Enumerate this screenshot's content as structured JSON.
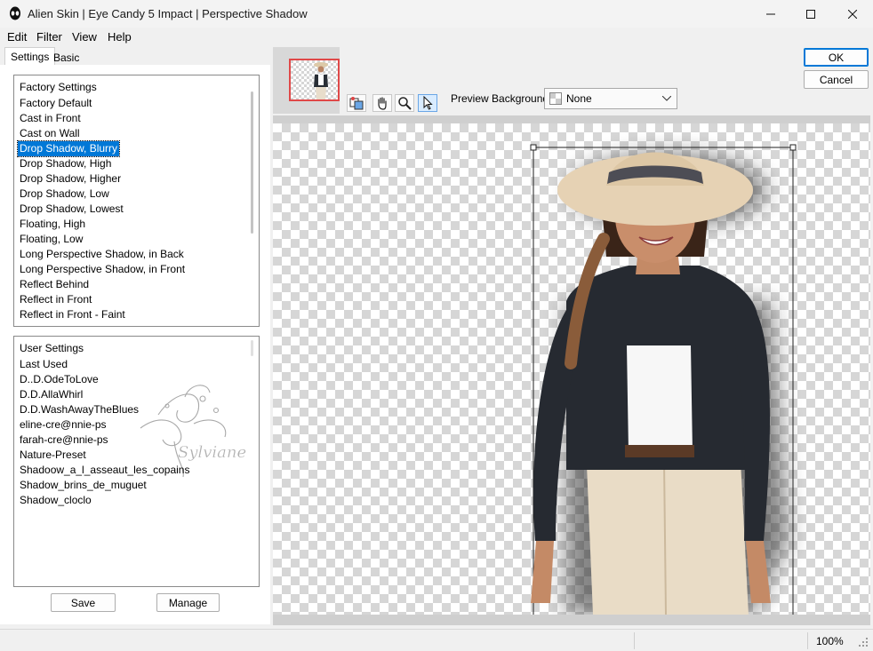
{
  "window": {
    "title": "Alien Skin | Eye Candy 5 Impact | Perspective Shadow",
    "app_icon": "alien-head-icon"
  },
  "menu": [
    "Edit",
    "Filter",
    "View",
    "Help"
  ],
  "tabs": [
    "Settings",
    "Basic"
  ],
  "factory_settings": {
    "heading": "Factory Settings",
    "items": [
      "Factory Default",
      "Cast in Front",
      "Cast on Wall",
      "Drop Shadow, Blurry",
      "Drop Shadow, High",
      "Drop Shadow, Higher",
      "Drop Shadow, Low",
      "Drop Shadow, Lowest",
      "Floating, High",
      "Floating, Low",
      "Long Perspective Shadow, in Back",
      "Long Perspective Shadow, in Front",
      "Reflect Behind",
      "Reflect in Front",
      "Reflect in Front - Faint"
    ],
    "selected": "Drop Shadow, Blurry"
  },
  "user_settings": {
    "heading": "User Settings",
    "items": [
      "Last Used",
      "D..D.OdeToLove",
      "D.D.AllaWhirl",
      "D.D.WashAwayTheBlues",
      "eline-cre@nnie-ps",
      "farah-cre@nnie-ps",
      "Nature-Preset",
      "Shadoow_a_l_asseaut_les_copains",
      "Shadow_brins_de_muguet",
      "Shadow_cloclo"
    ],
    "watermark": "Sylviane"
  },
  "buttons": {
    "save": "Save",
    "manage": "Manage",
    "ok": "OK",
    "cancel": "Cancel"
  },
  "preview_toolbar": {
    "tools": [
      "preview-toggle-icon",
      "hand-icon",
      "zoom-icon",
      "arrow-pointer-icon"
    ],
    "active_tool": "arrow-pointer-icon",
    "background_label": "Preview Background:",
    "background_value": "None"
  },
  "status": {
    "zoom": "100%"
  },
  "colors": {
    "selection": "#0078d7",
    "thumbnail_frame": "#e04848"
  }
}
